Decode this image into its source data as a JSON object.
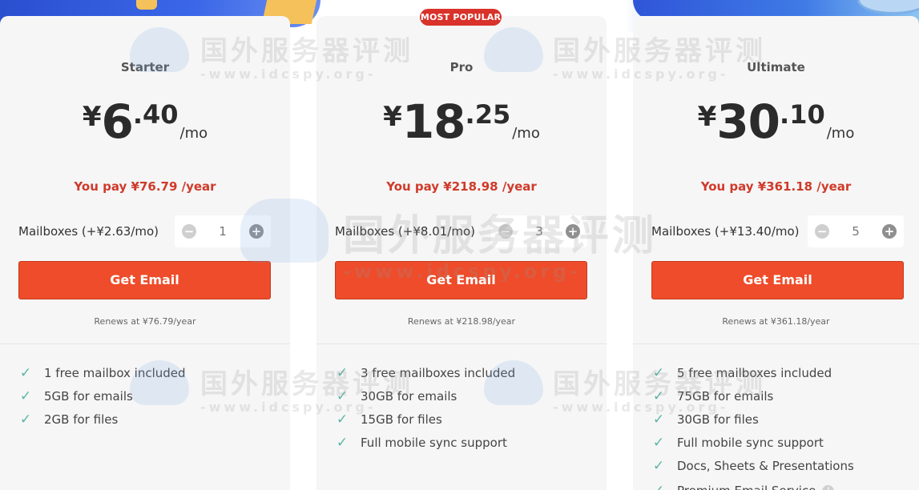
{
  "badge": "MOST POPULAR",
  "watermark": {
    "cn": "国外服务器评测",
    "en": "-www.idcspy.org-"
  },
  "plans": [
    {
      "name": "Starter",
      "currency": "¥",
      "price_whole": "6",
      "price_frac": ".40",
      "per": "/mo",
      "pay": "You pay ¥76.79 /year",
      "mailbox_label": "Mailboxes (+¥2.63/mo)",
      "qty": "1",
      "cta": "Get Email",
      "renew": "Renews at ¥76.79/year",
      "features": [
        "1 free mailbox included",
        "5GB for emails",
        "2GB for files"
      ]
    },
    {
      "name": "Pro",
      "currency": "¥",
      "price_whole": "18",
      "price_frac": ".25",
      "per": "/mo",
      "pay": "You pay ¥218.98 /year",
      "mailbox_label": "Mailboxes (+¥8.01/mo)",
      "qty": "3",
      "cta": "Get Email",
      "renew": "Renews at ¥218.98/year",
      "features": [
        "3 free mailboxes included",
        "30GB for emails",
        "15GB for files",
        "Full mobile sync support"
      ]
    },
    {
      "name": "Ultimate",
      "currency": "¥",
      "price_whole": "30",
      "price_frac": ".10",
      "per": "/mo",
      "pay": "You pay ¥361.18 /year",
      "mailbox_label": "Mailboxes (+¥13.40/mo)",
      "qty": "5",
      "cta": "Get Email",
      "renew": "Renews at ¥361.18/year",
      "features": [
        "5 free mailboxes included",
        "75GB for emails",
        "30GB for files",
        "Full mobile sync support",
        "Docs, Sheets & Presentations",
        "Premium Email Service"
      ]
    }
  ],
  "icons": {
    "check": "check-icon",
    "minus": "minus-icon",
    "plus": "plus-icon",
    "info": "info-icon"
  },
  "colors": {
    "cta": "#ee4c2a",
    "pay": "#cf3a2a",
    "check": "#5bb5a6",
    "badge": "#d8322a"
  }
}
